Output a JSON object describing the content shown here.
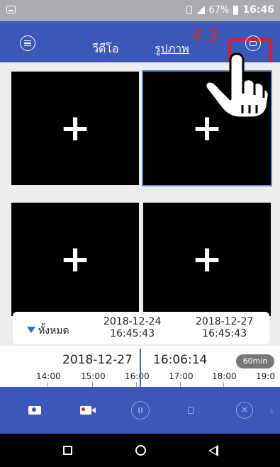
{
  "status_bar": {
    "battery_percent": "67%",
    "time": "16:46",
    "network": "4G",
    "icons": [
      "screen-icon",
      "vibrate-icon",
      "signal-icon",
      "battery-icon"
    ]
  },
  "header": {
    "menu_icon": "menu-list-icon",
    "tabs": [
      {
        "label": "วีดีโอ",
        "active": true
      },
      {
        "label": "รูปภาพ",
        "active": false
      }
    ],
    "step_label": "4.3",
    "right_icon": "camera-switch-icon",
    "highlight_color": "#e51a1a"
  },
  "video_tiles": [
    {
      "label": "+",
      "selected": false
    },
    {
      "label": "+",
      "selected": true
    },
    {
      "label": "+",
      "selected": false
    },
    {
      "label": "+",
      "selected": false
    }
  ],
  "filter": {
    "selected": "ทั้งหมด",
    "start_date": "2018-12-24",
    "start_time": "16:45:43",
    "end_date": "2018-12-27",
    "end_time": "16:45:43"
  },
  "timeline": {
    "current_date": "2018-12-27",
    "current_time": "16:06:14",
    "zoom": "60min",
    "ticks": [
      "14:00",
      "15:00",
      "16:00",
      "17:00",
      "18:00",
      "19:0"
    ]
  },
  "toolbar": {
    "icons": [
      "camera-icon",
      "record-icon",
      "pause-icon",
      "speaker-icon",
      "close-icon",
      "more-arrow-icon"
    ]
  },
  "nav_bar": {
    "icons": [
      "recent-apps-icon",
      "home-icon",
      "back-icon"
    ]
  },
  "colors": {
    "primary": "#3b57b7",
    "accent_blue": "#3b6bc7",
    "annotation_red": "#e5271f"
  }
}
